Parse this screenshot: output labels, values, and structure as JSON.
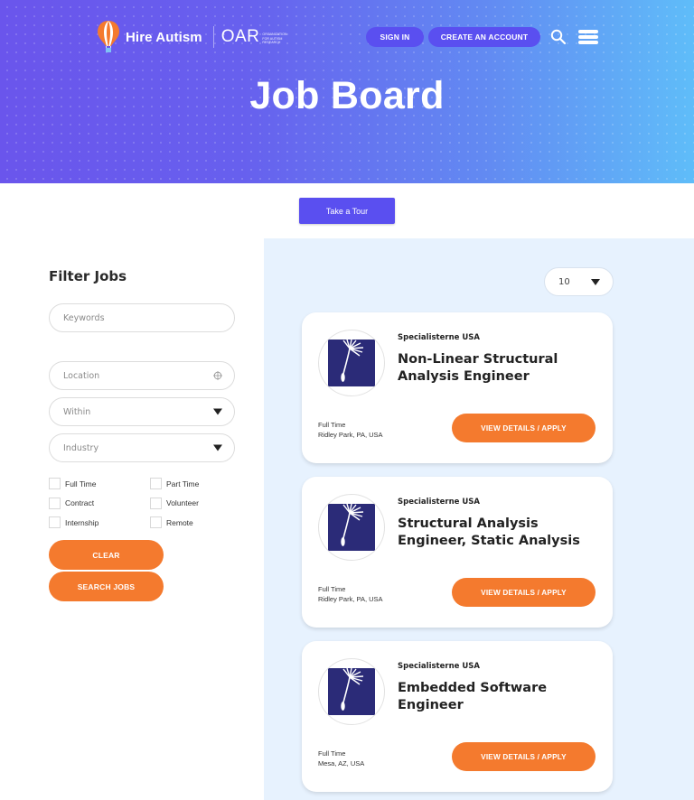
{
  "header": {
    "brand_name": "Hire Autism",
    "partner_logo_mark": "OAR",
    "partner_logo_sub": "Organization for Autism Research",
    "sign_in_label": "SIGN IN",
    "create_account_label": "CREATE AN ACCOUNT",
    "icons": {
      "search": "search-icon",
      "menu": "hamburger-menu-icon"
    },
    "gradient_colors": [
      "#6a55ec",
      "#5fbdf9"
    ]
  },
  "hero": {
    "title": "Job Board"
  },
  "tour": {
    "label": "Take a Tour"
  },
  "filters": {
    "title": "Filter Jobs",
    "keywords_placeholder": "Keywords",
    "location_placeholder": "Location",
    "within_placeholder": "Within",
    "industry_placeholder": "Industry",
    "job_types": [
      {
        "label": "Full Time",
        "checked": false
      },
      {
        "label": "Part Time",
        "checked": false
      },
      {
        "label": "Contract",
        "checked": false
      },
      {
        "label": "Volunteer",
        "checked": false
      },
      {
        "label": "Internship",
        "checked": false
      },
      {
        "label": "Remote",
        "checked": false
      }
    ],
    "clear_label": "CLEAR",
    "search_label": "SEARCH JOBS"
  },
  "results": {
    "per_page": "10",
    "jobs": [
      {
        "company": "Specialisterne USA",
        "title": "Non-Linear Structural Analysis Engineer",
        "type": "Full Time",
        "location": "Ridley Park, PA, USA",
        "apply_label": "VIEW DETAILS / APPLY"
      },
      {
        "company": "Specialisterne USA",
        "title": "Structural Analysis Engineer, Static Analysis",
        "type": "Full Time",
        "location": "Ridley Park, PA, USA",
        "apply_label": "VIEW DETAILS / APPLY"
      },
      {
        "company": "Specialisterne USA",
        "title": "Embedded Software Engineer",
        "type": "Full Time",
        "location": "Mesa, AZ, USA",
        "apply_label": "VIEW DETAILS / APPLY"
      }
    ]
  },
  "colors": {
    "accent_purple": "#5a4ff0",
    "accent_orange": "#f47a2e",
    "results_bg": "#e7f2fe",
    "company_logo_bg": "#2b2b78"
  }
}
